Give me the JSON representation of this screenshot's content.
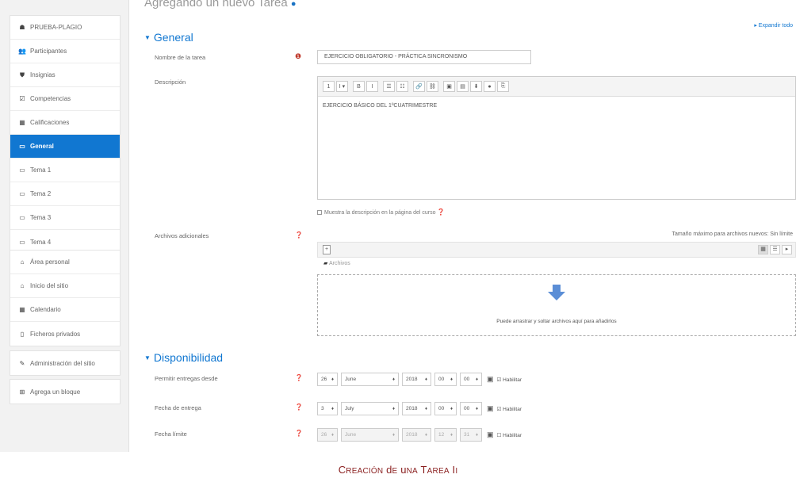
{
  "page": {
    "heading": "Agregando un nuevo Tarea",
    "expand_all": "Expandir todo",
    "caption": "Creación de una Tarea II"
  },
  "sidebar": {
    "groups": [
      {
        "items": [
          {
            "icon": "graduation-cap-icon",
            "glyph": "☗",
            "label": "PRUEBA-PLAGIO",
            "active": false
          },
          {
            "icon": "users-icon",
            "glyph": "👥",
            "label": "Participantes",
            "active": false
          },
          {
            "icon": "shield-icon",
            "glyph": "⛊",
            "label": "Insignias",
            "active": false
          },
          {
            "icon": "checkbox-icon",
            "glyph": "☑",
            "label": "Competencias",
            "active": false
          },
          {
            "icon": "grades-table-icon",
            "glyph": "▦",
            "label": "Calificaciones",
            "active": false
          },
          {
            "icon": "folder-icon",
            "glyph": "▭",
            "label": "General",
            "active": true
          },
          {
            "icon": "folder-icon",
            "glyph": "▭",
            "label": "Tema 1",
            "active": false
          },
          {
            "icon": "folder-icon",
            "glyph": "▭",
            "label": "Tema 2",
            "active": false
          },
          {
            "icon": "folder-icon",
            "glyph": "▭",
            "label": "Tema 3",
            "active": false
          },
          {
            "icon": "folder-icon",
            "glyph": "▭",
            "label": "Tema 4",
            "active": false
          }
        ]
      },
      {
        "items": [
          {
            "icon": "dashboard-icon",
            "glyph": "⌂",
            "label": "Área personal"
          },
          {
            "icon": "home-icon",
            "glyph": "⌂",
            "label": "Inicio del sitio"
          },
          {
            "icon": "calendar-icon",
            "glyph": "▦",
            "label": "Calendario"
          },
          {
            "icon": "file-icon",
            "glyph": "▯",
            "label": "Ficheros privados"
          }
        ]
      },
      {
        "items": [
          {
            "icon": "wrench-icon",
            "glyph": "✎",
            "label": "Administración del sitio"
          }
        ]
      },
      {
        "items": [
          {
            "icon": "plus-square-icon",
            "glyph": "⊞",
            "label": "Agrega un bloque"
          }
        ]
      }
    ]
  },
  "general": {
    "title": "General",
    "name_label": "Nombre de la tarea",
    "name_value": "EJERCICIO OBLIGATORIO - PRÁCTICA SINCRONISMO",
    "description_label": "Descripción",
    "description_value": "EJERCICIO BÁSICO DEL 1ºCUATRIMESTRE",
    "toolbar": [
      "1",
      "I ▾",
      "B",
      "I",
      "☰",
      "☷",
      "🔗",
      "⛓",
      "▣",
      "▤",
      "⬇",
      "●",
      "⎘"
    ],
    "show_desc_label": "Muestra la descripción en la página del curso",
    "files_label": "Archivos adicionales",
    "files_limit": "Tamaño máximo para archivos nuevos: Sin límite",
    "files_folder": "Archivos",
    "drop_text": "Puede arrastrar y soltar archivos aquí para añadirlos"
  },
  "availability": {
    "title": "Disponibilidad",
    "rows": [
      {
        "label": "Permitir entregas desde",
        "day": "26",
        "month": "June",
        "year": "2018",
        "hour": "00",
        "minute": "00",
        "enable": "Habilitar",
        "checked": true,
        "disabled": false
      },
      {
        "label": "Fecha de entrega",
        "day": "3",
        "month": "July",
        "year": "2018",
        "hour": "00",
        "minute": "00",
        "enable": "Habilitar",
        "checked": true,
        "disabled": false
      },
      {
        "label": "Fecha límite",
        "day": "26",
        "month": "June",
        "year": "2018",
        "hour": "12",
        "minute": "31",
        "enable": "Habilitar",
        "checked": false,
        "disabled": true
      }
    ]
  },
  "colors": {
    "accent": "#1177d1",
    "caption": "#8a1f1f",
    "required": "#c0392b"
  }
}
